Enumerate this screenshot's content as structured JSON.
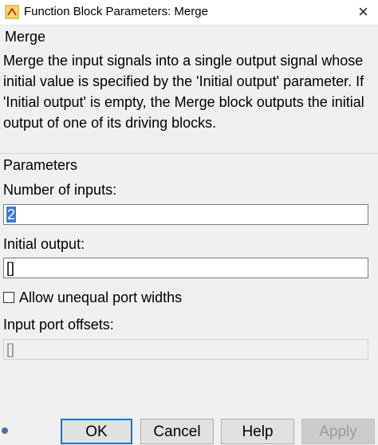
{
  "window": {
    "title": "Function Block Parameters: Merge",
    "icon": "simulink-block-icon",
    "close_icon": "×"
  },
  "block": {
    "name": "Merge",
    "description": "Merge the input signals into a single output signal whose initial value is specified by the 'Initial output' parameter. If 'Initial output' is empty, the Merge block outputs the initial output of one of its driving blocks."
  },
  "parameters": {
    "heading": "Parameters",
    "num_inputs_label": "Number of inputs:",
    "num_inputs_value": "2",
    "initial_output_label": "Initial output:",
    "initial_output_value": "[]",
    "allow_unequal_label": "Allow unequal port widths",
    "allow_unequal_checked": false,
    "port_offsets_label": "Input port offsets:",
    "port_offsets_value": "[]"
  },
  "buttons": {
    "ok": "OK",
    "cancel": "Cancel",
    "help": "Help",
    "apply": "Apply"
  },
  "colors": {
    "selection": "#3b78d8",
    "default_button_border": "#0078d7"
  }
}
